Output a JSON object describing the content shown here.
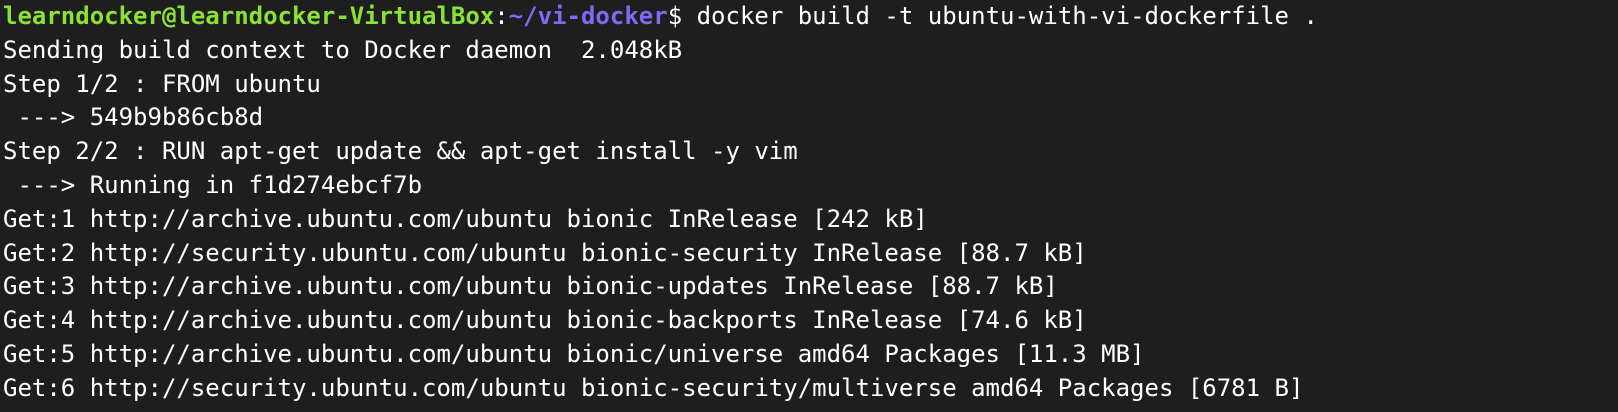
{
  "prompt": {
    "user_host": "learndocker@learndocker-VirtualBox",
    "colon": ":",
    "path": "~/vi-docker",
    "dollar": "$",
    "command": " docker build -t ubuntu-with-vi-dockerfile ."
  },
  "output_lines": [
    "Sending build context to Docker daemon  2.048kB",
    "Step 1/2 : FROM ubuntu",
    " ---> 549b9b86cb8d",
    "Step 2/2 : RUN apt-get update && apt-get install -y vim",
    " ---> Running in f1d274ebcf7b",
    "Get:1 http://archive.ubuntu.com/ubuntu bionic InRelease [242 kB]",
    "Get:2 http://security.ubuntu.com/ubuntu bionic-security InRelease [88.7 kB]",
    "Get:3 http://archive.ubuntu.com/ubuntu bionic-updates InRelease [88.7 kB]",
    "Get:4 http://archive.ubuntu.com/ubuntu bionic-backports InRelease [74.6 kB]",
    "Get:5 http://archive.ubuntu.com/ubuntu bionic/universe amd64 Packages [11.3 MB]",
    "Get:6 http://security.ubuntu.com/ubuntu bionic-security/multiverse amd64 Packages [6781 B]"
  ],
  "colors": {
    "background": "#1e1e1e",
    "text": "#ffffff",
    "user_host": "#8ae234",
    "path": "#7b6cf6"
  }
}
